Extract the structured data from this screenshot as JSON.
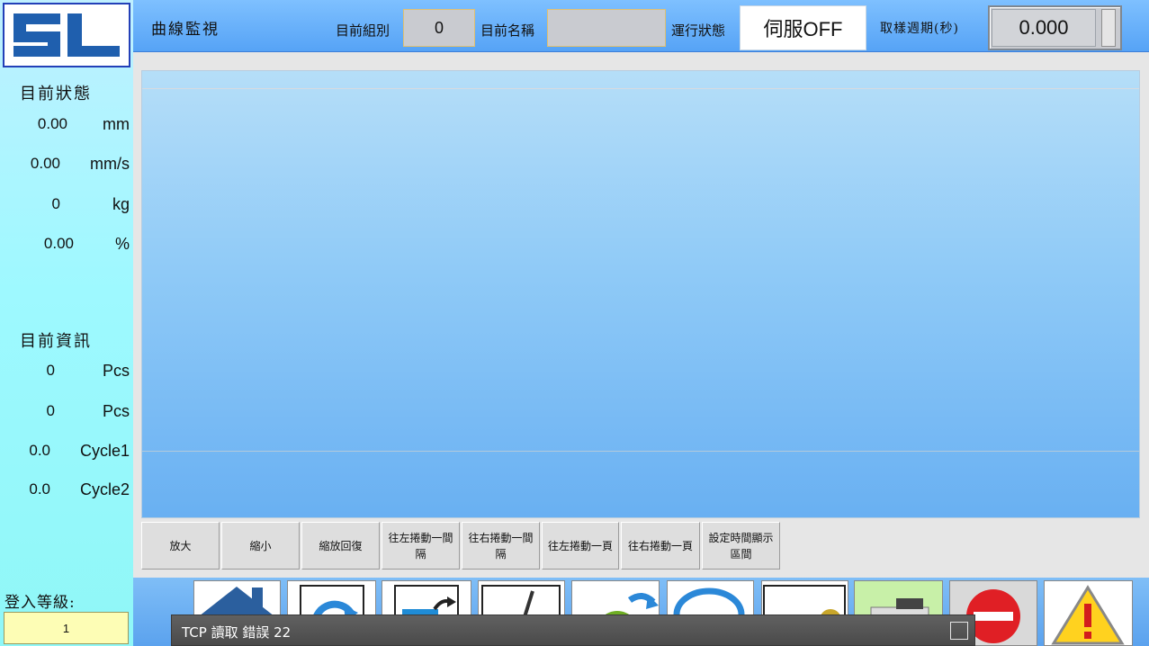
{
  "header": {
    "title": "曲線監視",
    "group_label": "目前組別",
    "group_value": "0",
    "name_label": "目前名稱",
    "name_value": "",
    "run_label": "運行狀態",
    "run_value": "伺服OFF",
    "period_label": "取樣週期(秒)",
    "period_value": "0.000"
  },
  "logo_text": "SL",
  "left": {
    "status_title": "目前狀態",
    "status": [
      {
        "value": "0.00",
        "unit": "mm"
      },
      {
        "value": "0.00",
        "unit": "mm/s"
      },
      {
        "value": "0",
        "unit": "kg"
      },
      {
        "value": "0.00",
        "unit": "%"
      }
    ],
    "info_title": "目前資訊",
    "info": [
      {
        "value": "0",
        "unit": "Pcs"
      },
      {
        "value": "0",
        "unit": "Pcs"
      },
      {
        "value": "0.0",
        "unit": "Cycle1"
      },
      {
        "value": "0.0",
        "unit": "Cycle2"
      }
    ],
    "login_label": "登入等級:",
    "login_value": "1"
  },
  "toolbar": [
    "放大",
    "縮小",
    "縮放回復",
    "往左捲動一間隔",
    "往右捲動一間隔",
    "往左捲動一頁",
    "往右捲動一頁",
    "設定時間顯示區間"
  ],
  "bottom_icons": [
    "home-icon",
    "refresh-icon",
    "folder-export-icon",
    "pen-icon",
    "settings-gear-icon",
    "magnifier-icon",
    "key-icon",
    "servo-motor-icon",
    "stop-icon",
    "warning-icon"
  ],
  "status_bar": {
    "message": "TCP 讀取 錯誤 22"
  },
  "colors": {
    "header_blue": "#56a3f6",
    "left_cyan": "#9ef9ff",
    "stop_red": "#e01f25",
    "warning_yellow": "#ffd21f"
  }
}
